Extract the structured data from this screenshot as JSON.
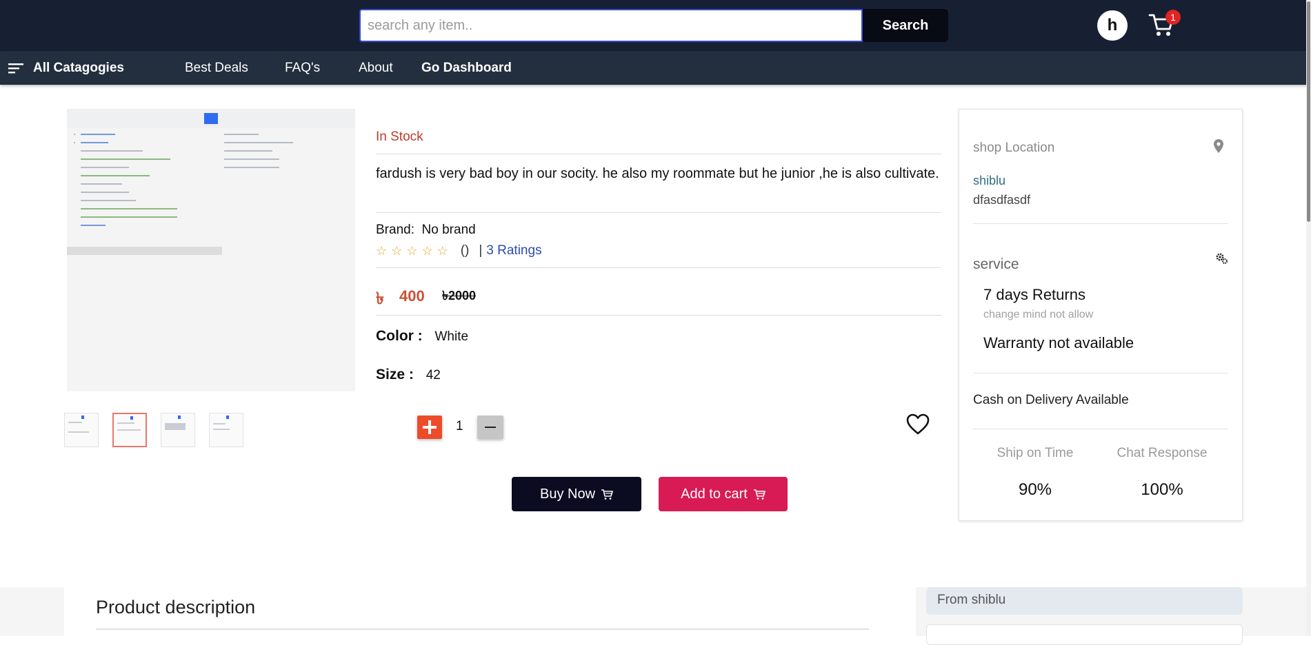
{
  "header": {
    "search_placeholder": "search any item..",
    "search_button": "Search",
    "avatar_letter": "h",
    "cart_count": "1",
    "colors": {
      "background": "#172033",
      "badge": "#e02424"
    }
  },
  "nav": {
    "all_categories": "All Catagogies",
    "links": [
      "Best Deals",
      "FAQ's",
      "About",
      "Go Dashboard"
    ]
  },
  "product": {
    "stock_status": "In Stock",
    "title": "fardush is very bad boy in our socity. he also my roommate but he junior ,he is also cultivate.",
    "brand_label": "Brand:",
    "brand_value": "No brand",
    "rating_count_paren": "()",
    "rating_sep": "|",
    "ratings_link": "3 Ratings",
    "stars": 0,
    "stars_max": 5,
    "currency_symbol": "৳",
    "price": "400",
    "old_price": "৳2000",
    "color_label": "Color :",
    "color_value": "White",
    "size_label": "Size :",
    "size_value": "42",
    "quantity": "1",
    "thumbnails": 4,
    "active_thumbnail": 2,
    "buy_now": "Buy Now",
    "add_to_cart": "Add to cart",
    "colors": {
      "accent": "#c95233",
      "stock": "#c0392b",
      "buy_button": "#0b0b22",
      "cart_button": "#d81b55",
      "plus_button": "#ee4b2b"
    }
  },
  "side_panel": {
    "location_title": "shop Location",
    "shop_name": "shiblu",
    "shop_address": "dfasdfasdf",
    "service_title": "service",
    "returns": "7 days Returns",
    "returns_note": "change mind not allow",
    "warranty": "Warranty not available",
    "cod": "Cash on Delivery Available",
    "metrics": [
      {
        "label": "Ship on Time",
        "value": "90%"
      },
      {
        "label": "Chat Response",
        "value": "100%"
      }
    ]
  },
  "bottom": {
    "description_title": "Product description",
    "from_seller": "From shiblu"
  },
  "icons": [
    "menu-icon",
    "cart-icon",
    "location-pin-icon",
    "gear-icon",
    "heart-icon",
    "star-icon",
    "plus-icon",
    "minus-icon"
  ]
}
